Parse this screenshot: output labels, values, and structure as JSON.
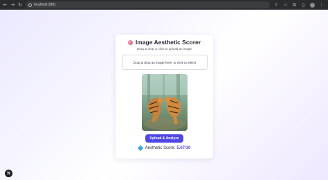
{
  "browser": {
    "url": "localhost:3001",
    "icons": [
      "back-icon",
      "forward-icon",
      "reload-icon",
      "site-info-icon",
      "share-icon",
      "bookmark-star-icon",
      "extensions-icon",
      "sidebar-icon",
      "profile-icon",
      "menu-icon"
    ]
  },
  "app": {
    "title": "Image Aesthetic Scorer",
    "subtitle": "Drag & drop or click to upload an image",
    "dropzone_text": "Drag & drop an image here, or click to select",
    "upload_button": "Upload & Analyze",
    "score_label": "Aesthetic Score:",
    "score_value": "5.67/10",
    "accent_color": "#4f46e5"
  },
  "dev_badge": "N"
}
